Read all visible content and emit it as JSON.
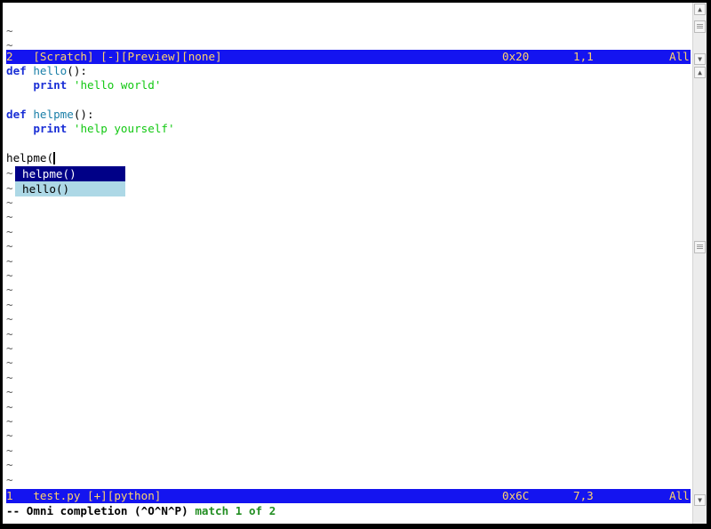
{
  "upper_window": {
    "tildes_above": [
      "~",
      "~"
    ],
    "status": {
      "left": "2   [Scratch] [-][Preview][none]",
      "bytes": "0x20",
      "position": "1,1",
      "scroll": "All"
    }
  },
  "code": {
    "line1": {
      "kw": "def",
      "name": "hello",
      "rest": "():"
    },
    "line2": {
      "kw": "print",
      "str": "'hello world'"
    },
    "line4": {
      "kw": "def",
      "name": "helpme",
      "rest": "():"
    },
    "line5": {
      "kw": "print",
      "str": "'help yourself'"
    },
    "line7": {
      "text": "helpme("
    }
  },
  "popup": {
    "items": [
      "helpme()",
      "hello()"
    ],
    "selected_index": 0
  },
  "filler_tilde": "~",
  "lower_status": {
    "left": "1   test.py [+][python]",
    "bytes": "0x6C",
    "position": "7,3",
    "scroll": "All"
  },
  "cmdline": {
    "mode": "-- Omni completion (^O^N^P)",
    "match": "match 1 of 2"
  },
  "scrollbar": {
    "up_icon": "arrow-up-icon",
    "down_icon": "arrow-down-icon"
  }
}
